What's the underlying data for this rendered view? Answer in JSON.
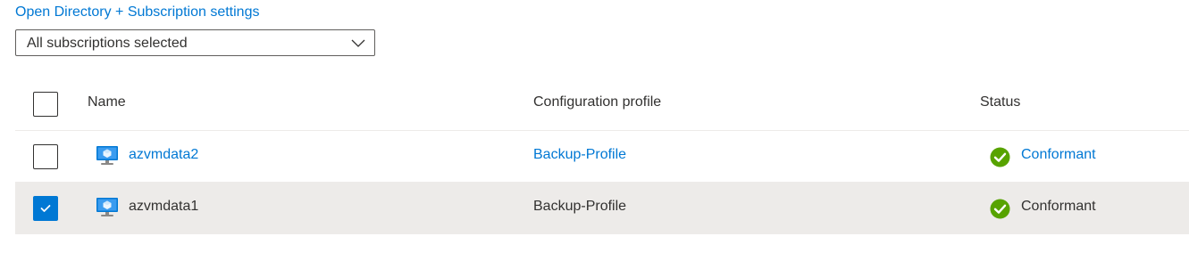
{
  "header_link": "Open Directory + Subscription settings",
  "subscription_filter": {
    "value": "All subscriptions selected"
  },
  "table": {
    "columns": {
      "name": "Name",
      "profile": "Configuration profile",
      "status": "Status"
    },
    "rows": [
      {
        "name": "azvmdata2",
        "profile": "Backup-Profile",
        "status": "Conformant",
        "selected": false
      },
      {
        "name": "azvmdata1",
        "profile": "Backup-Profile",
        "status": "Conformant",
        "selected": true
      }
    ]
  },
  "colors": {
    "accent": "#0078d4",
    "success": "#57a300",
    "selected_row": "#edebe9"
  }
}
